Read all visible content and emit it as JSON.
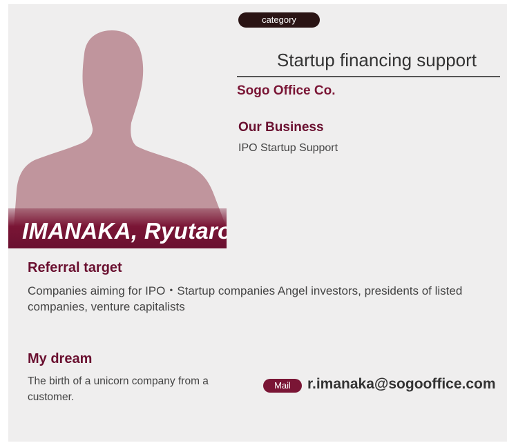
{
  "profile": {
    "name": "IMANAKA, Ryutaro",
    "category_label": "category",
    "category": "Startup financing support",
    "company": "Sogo Office Co."
  },
  "business": {
    "heading": "Our Business",
    "text": "IPO Startup Support"
  },
  "referral": {
    "heading": "Referral target",
    "text": "Companies aiming for IPO・Startup companies Angel investors, presidents of listed companies, venture capitalists"
  },
  "dream": {
    "heading": "My dream",
    "text": "The birth of a unicorn company from a customer."
  },
  "contact": {
    "mail_label": "Mail",
    "email": "r.imanaka@sogooffice.com"
  },
  "colors": {
    "accent": "#6a1030",
    "silhouette": "#c0959d",
    "background": "#efeeee"
  }
}
